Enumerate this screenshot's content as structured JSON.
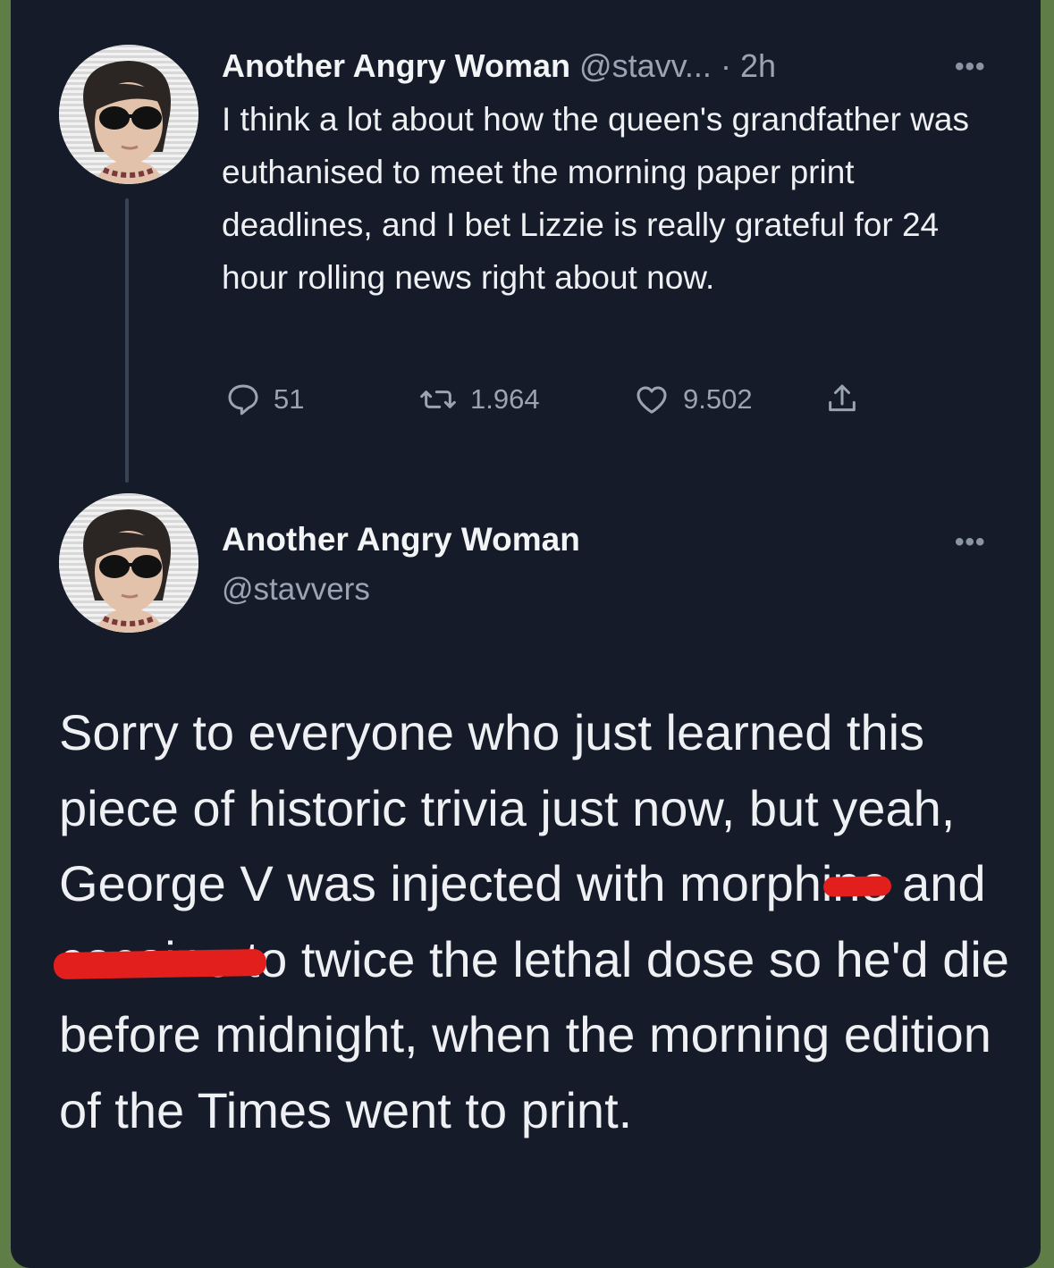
{
  "tweet1": {
    "author_name": "Another Angry Woman",
    "handle_truncated": "@stavv...",
    "separator": "·",
    "time": "2h",
    "more_label": "•••",
    "text": "I think a lot about how the queen's grandfather was euthanised to meet the morning paper print deadlines, and I bet Lizzie is really grateful for 24 hour rolling news right about now.",
    "replies": "51",
    "retweets": "1.964",
    "likes": "9.502"
  },
  "tweet2": {
    "author_name": "Another Angry Woman",
    "handle": "@stavvers",
    "more_label": "•••",
    "text_before": "Sorry to everyone who just learned this piece of historic trivia just now, but yeah, George V was injected with morphi",
    "redacted_part1": "ne",
    "text_middle": " and ",
    "redacted_part2": "cocaine t",
    "text_after": "o twice the lethal dose so he'd die before midnight, when the morning edition of the Times went to print."
  },
  "colors": {
    "background": "#151b28",
    "primary_text": "#eef0f3",
    "secondary_text": "#9aa4b3",
    "redaction": "#e21f1c",
    "outer_border": "#5f7d46"
  },
  "icons": [
    "avatar",
    "more-icon",
    "reply-icon",
    "retweet-icon",
    "like-icon",
    "share-icon"
  ]
}
